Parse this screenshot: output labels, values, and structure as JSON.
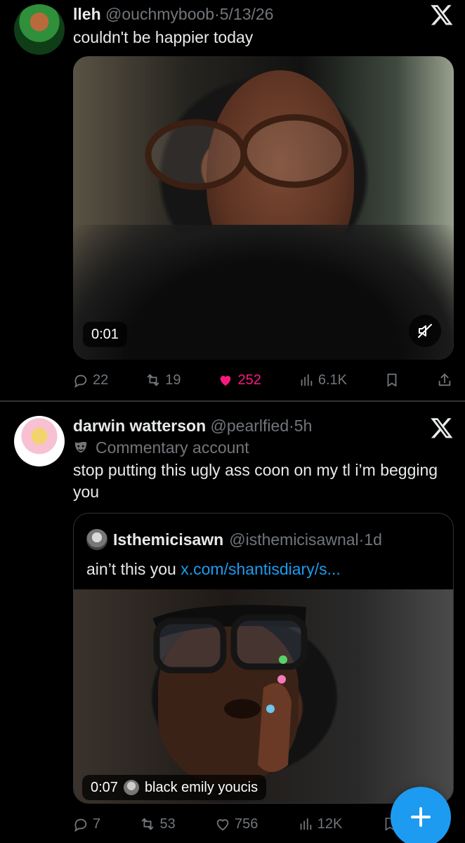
{
  "tweet1": {
    "name": "lleh",
    "handle": "@ouchmyboob",
    "dot": "·",
    "time": "5/13/26",
    "text": "couldn't be happier today",
    "video_time": "0:01",
    "replies": "22",
    "reposts": "19",
    "likes": "252",
    "views": "6.1K"
  },
  "tweet2": {
    "name": "darwin watterson",
    "handle": "@pearlfied",
    "dot": "·",
    "time": "5h",
    "label": "Commentary account",
    "text": "stop putting this ugly ass coon on my tl i’m begging you",
    "quote": {
      "name": "Isthemicisawn",
      "handle": "@isthemicisawnal",
      "dot": "·",
      "time": "1d",
      "text": "ain’t this you",
      "link": "x.com/shantisdiary/s...",
      "video_time": "0:07",
      "video_user": "black emily youcis"
    },
    "replies": "7",
    "reposts": "53",
    "likes": "756",
    "views": "12K"
  },
  "colors": {
    "background": "#000000",
    "text": "#e7e9ea",
    "muted": "#71767b",
    "accent": "#1d9bf0",
    "like": "#f91880",
    "border": "#2f3336"
  },
  "icons": [
    "x-logo-icon",
    "reply-icon",
    "repost-icon",
    "like-icon",
    "views-icon",
    "bookmark-icon",
    "share-icon",
    "mute-icon",
    "mask-icon",
    "plus-icon"
  ]
}
